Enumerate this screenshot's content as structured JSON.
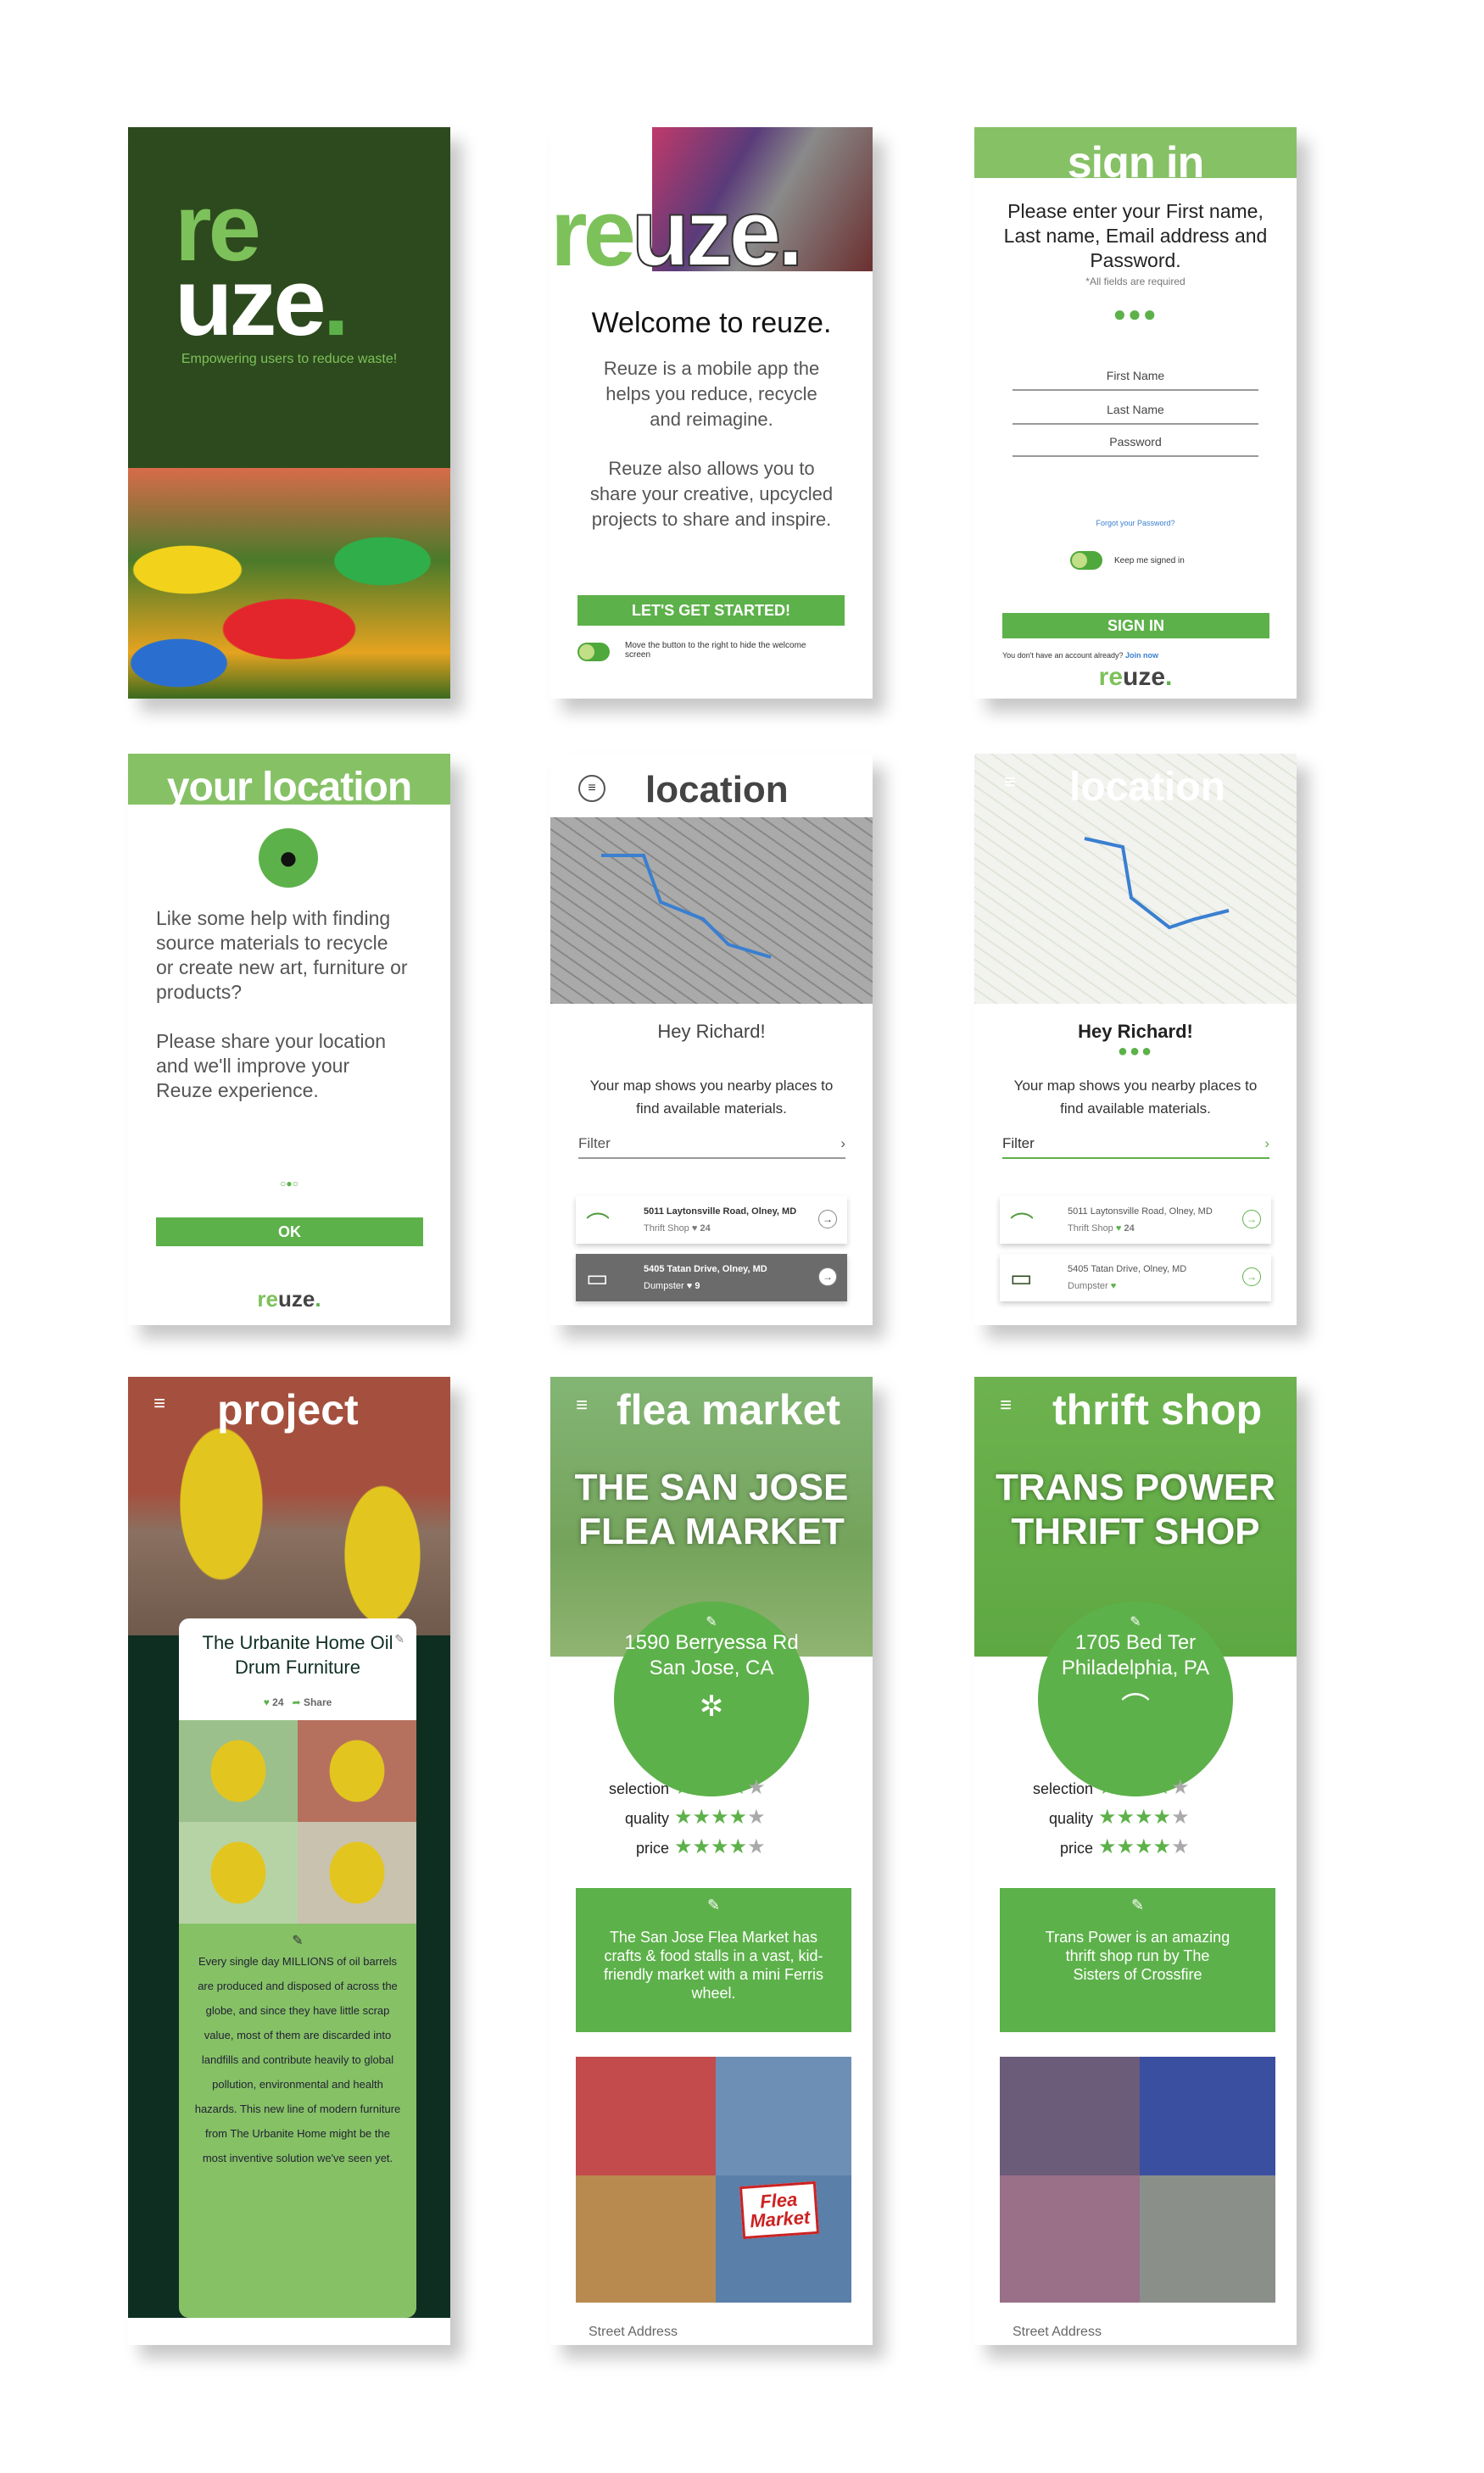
{
  "colors": {
    "brand_green": "#5db14a",
    "light_green": "#86c166",
    "dark_green": "#2d4a1e",
    "project_bg": "#0f2e22"
  },
  "splash": {
    "logo_top": "re",
    "logo_bottom": "uze",
    "logo_dot": ".",
    "tagline": "Empowering users to reduce waste!"
  },
  "welcome": {
    "logo_green": "re",
    "logo_rest": "uze.",
    "title": "Welcome to reuze.",
    "para1": "Reuze is a mobile app the helps you reduce, recycle and reimagine.",
    "para2": "Reuze also allows you to share your creative, upcycled projects to share and inspire.",
    "button": "LET'S GET STARTED!",
    "toggle_label": "Move the button to the right to hide the welcome screen"
  },
  "signin": {
    "title": "sign in",
    "intro": "Please enter your First name, Last name, Email address and Password.",
    "required": "*All fields are required",
    "fields": [
      "First Name",
      "Last Name",
      "Password"
    ],
    "forgot": "Forgot your Password?",
    "keep": "Keep me signed in",
    "button": "SIGN IN",
    "no_account": "You don't have an account already?",
    "join": "Join now",
    "logo_green": "re",
    "logo_rest": "uze",
    "logo_dot": "."
  },
  "your_location": {
    "title": "your location",
    "para1": "Like some help with finding source materials to recycle or create new art, furniture or products?",
    "para2": "Please share your location and we'll improve your Reuze experience.",
    "button": "OK",
    "logo_green": "re",
    "logo_rest": "uze",
    "logo_dot": "."
  },
  "location": {
    "title": "location",
    "greeting": "Hey Richard!",
    "desc": "Your map shows you nearby places to find available materials.",
    "filter": "Filter",
    "places": [
      {
        "address": "5011 Laytonsville Road, Olney, MD",
        "type": "Thrift Shop",
        "likes": "24",
        "icon": "hanger-icon"
      },
      {
        "address": "5405 Tatan Drive, Olney, MD",
        "type": "Dumpster",
        "likes": "9",
        "icon": "dumpster-icon"
      }
    ]
  },
  "project": {
    "title": "project",
    "name": "The Urbanite Home Oil Drum Furniture",
    "likes": "24",
    "share": "Share",
    "description": "Every single day MILLIONS of oil barrels are produced and disposed of across the globe, and since they have little scrap value, most of them are discarded into landfills and contribute heavily to global pollution, environmental and health hazards. This new line of modern furniture from The Urbanite Home might be the most inventive solution we've seen yet."
  },
  "flea": {
    "title": "flea market",
    "name": "THE SAN JOSE FLEA MARKET",
    "address1": "1590 Berryessa Rd",
    "address2": "San Jose, CA",
    "ratings": [
      {
        "label": "selection",
        "stars": 4
      },
      {
        "label": "quality",
        "stars": 4
      },
      {
        "label": "price",
        "stars": 4
      }
    ],
    "description": "The San Jose Flea Market has crafts & food stalls in a vast, kid-friendly market with a mini Ferris wheel.",
    "photo_sign": "Flea Market",
    "street_label": "Street Address"
  },
  "thrift": {
    "title": "thrift shop",
    "name": "TRANS POWER THRIFT SHOP",
    "address1": "1705 Bed Ter",
    "address2": "Philadelphia, PA",
    "ratings": [
      {
        "label": "selection",
        "stars": 4
      },
      {
        "label": "quality",
        "stars": 4
      },
      {
        "label": "price",
        "stars": 4
      }
    ],
    "description": "Trans Power is an amazing thrift shop run by The Sisters of Crossfire",
    "street_label": "Street Address"
  }
}
